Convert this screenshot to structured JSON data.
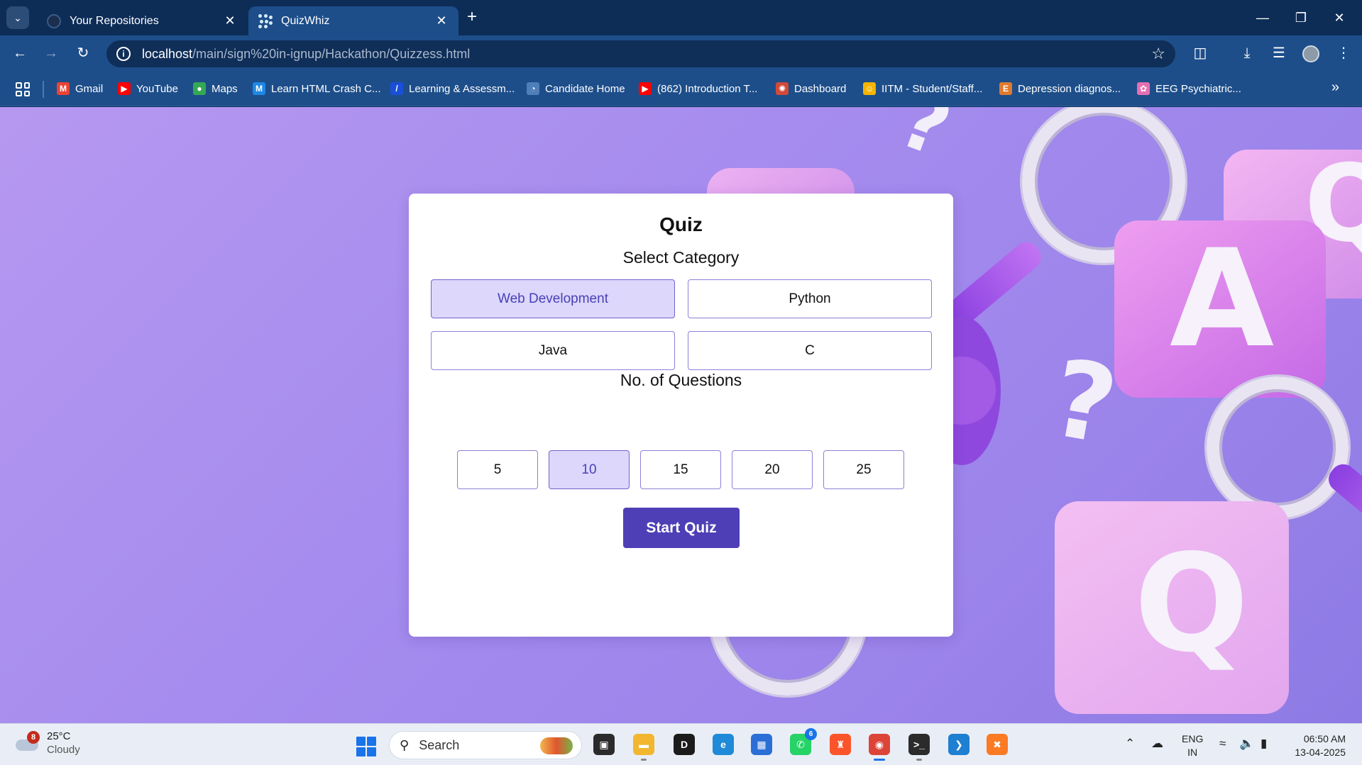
{
  "browser": {
    "tabs": [
      {
        "title": "Your Repositories",
        "active": false,
        "icon": "github-icon"
      },
      {
        "title": "QuizWhiz",
        "active": true,
        "icon": "quizwhiz-favicon"
      }
    ],
    "url": {
      "host": "localhost",
      "path": "/main/sign%20in-ignup/Hackathon/Quizzess.html"
    },
    "bookmarks": [
      {
        "label": "Gmail",
        "icon": "gmail-icon",
        "color": "#ea4335"
      },
      {
        "label": "YouTube",
        "icon": "youtube-icon",
        "color": "#ff0000"
      },
      {
        "label": "Maps",
        "icon": "maps-icon",
        "color": "#34a853"
      },
      {
        "label": "Learn HTML Crash C...",
        "icon": "m-logo-icon",
        "color": "#1e88e5"
      },
      {
        "label": "Learning & Assessm...",
        "icon": "learning-icon",
        "color": "#1a4fd8"
      },
      {
        "label": "Candidate Home",
        "icon": "candidate-icon",
        "color": "#4f7fb8"
      },
      {
        "label": "(862) Introduction T...",
        "icon": "youtube-icon",
        "color": "#ff0000"
      },
      {
        "label": "Dashboard",
        "icon": "dashboard-icon",
        "color": "#d04a3a"
      },
      {
        "label": "IITM - Student/Staff...",
        "icon": "emoji-icon",
        "color": "#f4b400"
      },
      {
        "label": "Depression diagnos...",
        "icon": "e-logo-icon",
        "color": "#e07a2d"
      },
      {
        "label": "EEG Psychiatric...",
        "icon": "brain-icon",
        "color": "#e66fb1"
      }
    ]
  },
  "quiz": {
    "title": "Quiz",
    "category_label": "Select Category",
    "categories": [
      {
        "label": "Web Development",
        "selected": true
      },
      {
        "label": "Python",
        "selected": false
      },
      {
        "label": "Java",
        "selected": false
      },
      {
        "label": "C",
        "selected": false
      }
    ],
    "questions_label": "No. of Questions",
    "question_counts": [
      {
        "label": "5",
        "selected": false
      },
      {
        "label": "10",
        "selected": true
      },
      {
        "label": "15",
        "selected": false
      },
      {
        "label": "20",
        "selected": false
      },
      {
        "label": "25",
        "selected": false
      }
    ],
    "start_label": "Start Quiz",
    "accent_color": "#4f3fb6"
  },
  "background_letters": [
    "Q",
    "A",
    "Q"
  ],
  "taskbar": {
    "weather": {
      "temp": "25°C",
      "condition": "Cloudy",
      "badge": "8"
    },
    "search_placeholder": "Search",
    "apps": [
      {
        "name": "file-explorer-taskview-icon"
      },
      {
        "name": "file-explorer-icon"
      },
      {
        "name": "dell-icon"
      },
      {
        "name": "edge-icon"
      },
      {
        "name": "store-icon"
      },
      {
        "name": "whatsapp-icon",
        "badge": "6"
      },
      {
        "name": "brave-icon"
      },
      {
        "name": "chrome-icon"
      },
      {
        "name": "terminal-icon"
      },
      {
        "name": "vscode-icon"
      },
      {
        "name": "xampp-icon"
      }
    ],
    "lang": {
      "line1": "ENG",
      "line2": "IN"
    },
    "time": "06:50 AM",
    "date": "13-04-2025"
  }
}
